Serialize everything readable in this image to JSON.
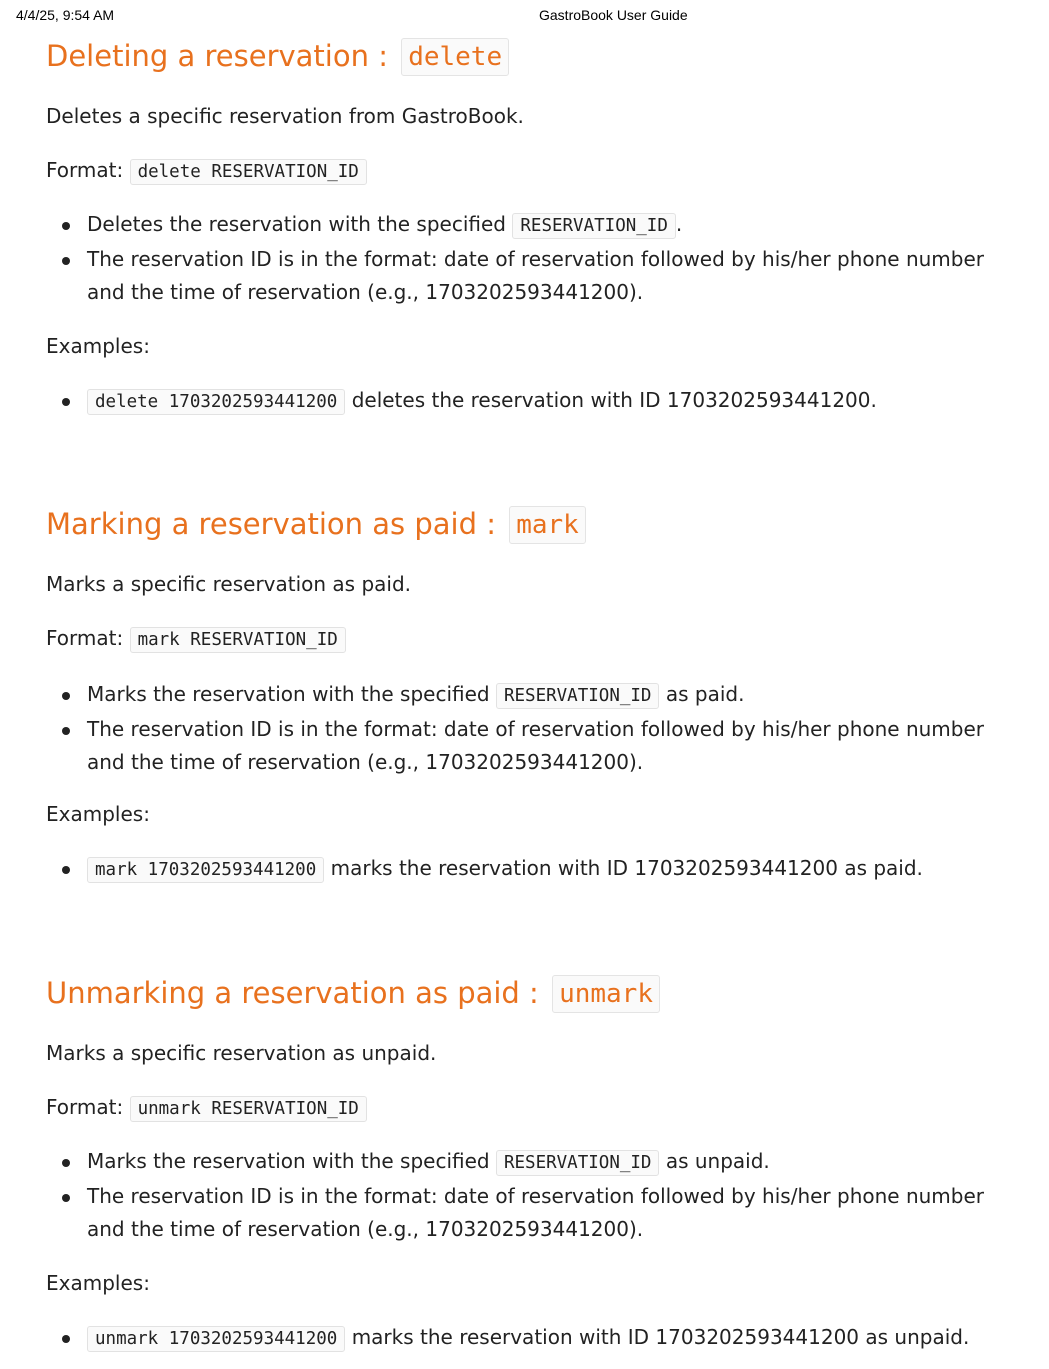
{
  "print_header": {
    "datetime": "4/4/25, 9:54 AM",
    "title": "GastroBook User Guide"
  },
  "sections": [
    {
      "heading": "Deleting a reservation : ",
      "heading_code": "delete",
      "description": "Deletes a specific reservation from GastroBook.",
      "format_label": "Format:",
      "format_code": "delete RESERVATION_ID",
      "bullets": [
        {
          "before": "Deletes the reservation with the specified",
          "code": "RESERVATION_ID",
          "after": "."
        },
        {
          "text": "The reservation ID is in the format: date of reservation followed by his/her phone number and the time of reservation (e.g., 1703202593441200)."
        }
      ],
      "examples_label": "Examples:",
      "example": {
        "code": "delete 1703202593441200",
        "text": "deletes the reservation with ID 1703202593441200."
      }
    },
    {
      "heading": "Marking a reservation as paid : ",
      "heading_code": "mark",
      "description": "Marks a specific reservation as paid.",
      "format_label": "Format:",
      "format_code": "mark RESERVATION_ID",
      "bullets": [
        {
          "before": "Marks the reservation with the specified",
          "code": "RESERVATION_ID",
          "after": "as paid."
        },
        {
          "text": "The reservation ID is in the format: date of reservation followed by his/her phone number and the time of reservation (e.g., 1703202593441200)."
        }
      ],
      "examples_label": "Examples:",
      "example": {
        "code": "mark 1703202593441200",
        "text": "marks the reservation with ID 1703202593441200 as paid."
      }
    },
    {
      "heading": "Unmarking a reservation as paid : ",
      "heading_code": "unmark",
      "description": "Marks a specific reservation as unpaid.",
      "format_label": "Format:",
      "format_code": "unmark RESERVATION_ID",
      "bullets": [
        {
          "before": "Marks the reservation with the specified",
          "code": "RESERVATION_ID",
          "after": "as unpaid."
        },
        {
          "text": "The reservation ID is in the format: date of reservation followed by his/her phone number and the time of reservation (e.g., 1703202593441200)."
        }
      ],
      "examples_label": "Examples:",
      "example": {
        "code": "unmark 1703202593441200",
        "text": "marks the reservation with ID 1703202593441200 as unpaid."
      }
    }
  ]
}
